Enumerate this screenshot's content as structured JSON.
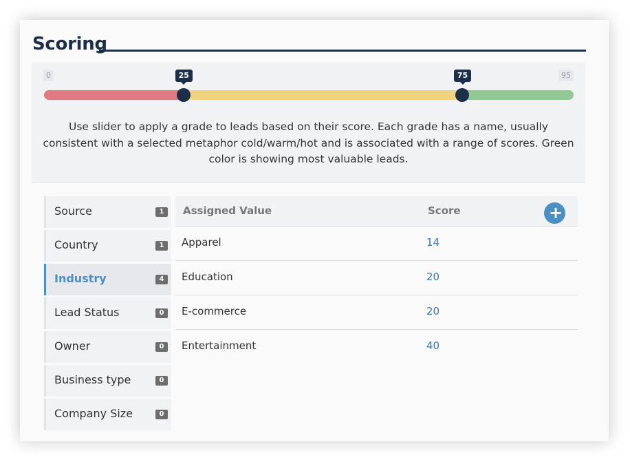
{
  "header": {
    "title": "Scoring"
  },
  "slider": {
    "min_label": "0",
    "max_label": "95",
    "min": 0,
    "max": 95,
    "handles": [
      "25",
      "75"
    ],
    "handle_values": [
      25,
      75
    ],
    "colors": {
      "cold": "#e07a80",
      "warm": "#f2d27f",
      "hot": "#91c995",
      "handle": "#1c2f4a"
    },
    "help_text": "Use slider to apply a grade to leads based on their score. Each grade has a name, usually consistent with a selected metaphor cold/warm/hot and is associated with a range of scores. Green color is showing most valuable leads."
  },
  "nav": {
    "items": [
      {
        "label": "Source",
        "count": "1"
      },
      {
        "label": "Country",
        "count": "1"
      },
      {
        "label": "Industry",
        "count": "4",
        "active": true
      },
      {
        "label": "Lead Status",
        "count": "0"
      },
      {
        "label": "Owner",
        "count": "0"
      },
      {
        "label": "Business type",
        "count": "0"
      },
      {
        "label": "Company Size",
        "count": "0"
      }
    ]
  },
  "table": {
    "col_value": "Assigned Value",
    "col_score": "Score",
    "add_icon": "plus-icon",
    "add_label": "+",
    "rows": [
      {
        "value": "Apparel",
        "score": "14"
      },
      {
        "value": "Education",
        "score": "20"
      },
      {
        "value": "E-commerce",
        "score": "20"
      },
      {
        "value": "Entertainment",
        "score": "40"
      }
    ]
  },
  "accent": "#4a8fc6"
}
